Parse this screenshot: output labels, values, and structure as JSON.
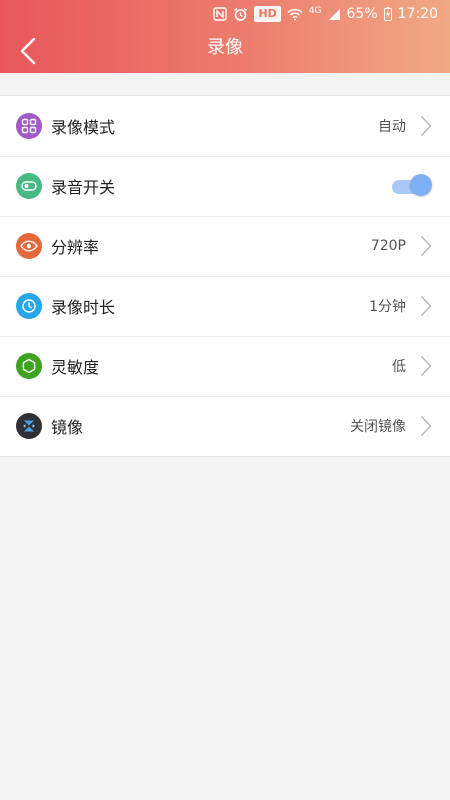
{
  "status_bar": {
    "hd_label": "HD",
    "network": "4G",
    "battery": "65%",
    "time": "17:20"
  },
  "header": {
    "title": "录像",
    "gradient_start": "#e8575b",
    "gradient_end": "#f0aa84"
  },
  "settings": {
    "items": [
      {
        "label": "录像模式",
        "value": "自动",
        "icon": "grid-icon",
        "icon_color": "#a25bc4"
      },
      {
        "label": "录音开关",
        "icon": "toggle-icon",
        "icon_color": "#48b985",
        "toggle_on": true
      },
      {
        "label": "分辨率",
        "value": "720P",
        "icon": "eye-icon",
        "icon_color": "#e4683a"
      },
      {
        "label": "录像时长",
        "value": "1分钟",
        "icon": "clock-icon",
        "icon_color": "#27a7ea"
      },
      {
        "label": "灵敏度",
        "value": "低",
        "icon": "hexagon-icon",
        "icon_color": "#3ea31e"
      },
      {
        "label": "镜像",
        "value": "关闭镜像",
        "icon": "mirror-icon",
        "icon_color": "#2e3136"
      }
    ]
  },
  "colors": {
    "toggle_track": "#a9c8f5",
    "toggle_thumb": "#7db0f3",
    "background": "#f3f3f3"
  }
}
